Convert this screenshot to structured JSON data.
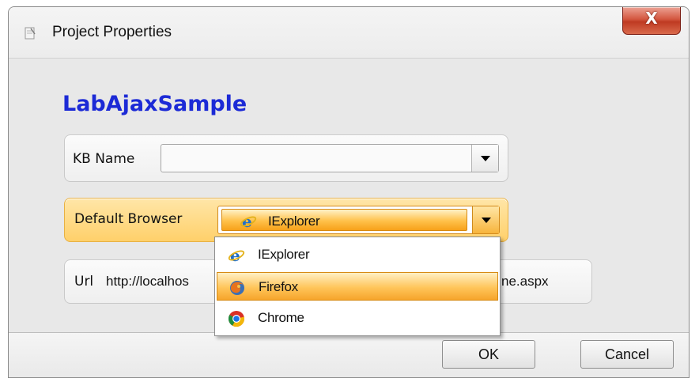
{
  "window": {
    "title": "Project Properties",
    "close_label": "X"
  },
  "project": {
    "name": "LabAjaxSample"
  },
  "kb_name": {
    "label": "KB Name",
    "value": ""
  },
  "default_browser": {
    "label": "Default Browser",
    "selected": "IExplorer",
    "options": [
      "IExplorer",
      "Firefox",
      "Chrome"
    ],
    "highlighted_option": "Firefox"
  },
  "url": {
    "label": "Url",
    "value_left": "http://localhos",
    "value_right": "ne.aspx"
  },
  "buttons": {
    "ok": "OK",
    "cancel": "Cancel"
  },
  "colors": {
    "title_blue": "#1c2ad6",
    "highlight_orange": "#ffc14a"
  }
}
